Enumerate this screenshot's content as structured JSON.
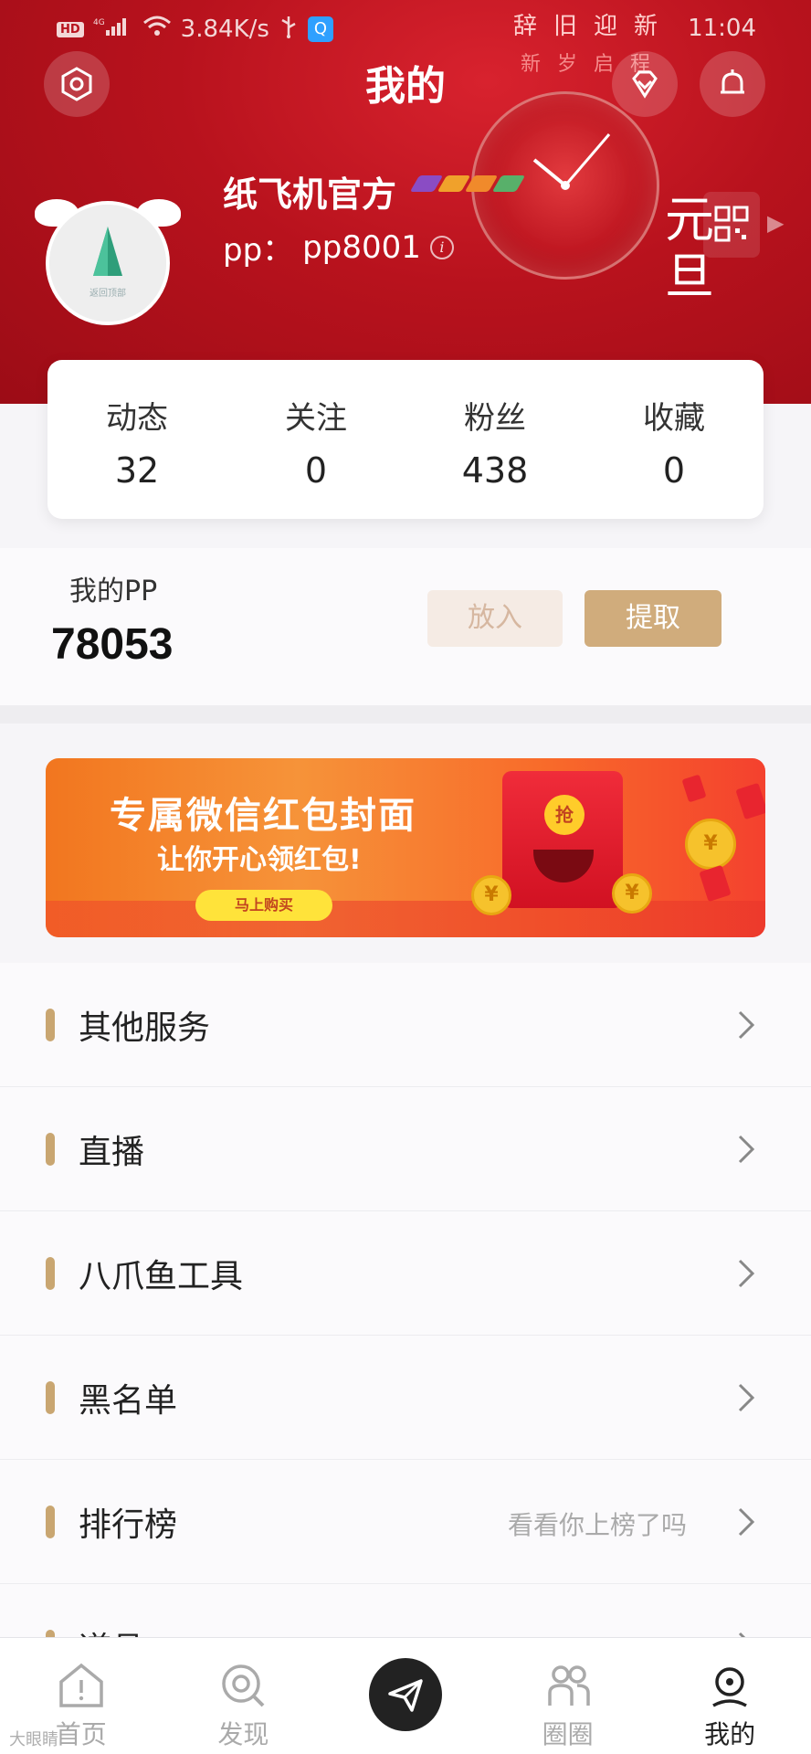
{
  "status_bar": {
    "network_label": "HD",
    "signal_label": "4G",
    "speed": "3.84K/s",
    "time": "11:04"
  },
  "festival": {
    "line1": "辞旧迎新",
    "line2": "新岁启程",
    "yuandan": "元旦"
  },
  "header": {
    "title": "我的",
    "username": "纸飞机官方",
    "pp_label": "pp：",
    "pp_id": "pp8001",
    "avatar_caption": "返回顶部"
  },
  "stats": [
    {
      "label": "动态",
      "value": "32"
    },
    {
      "label": "关注",
      "value": "0"
    },
    {
      "label": "粉丝",
      "value": "438"
    },
    {
      "label": "收藏",
      "value": "0"
    }
  ],
  "wallet": {
    "label": "我的PP",
    "amount": "78053",
    "deposit_label": "放入",
    "withdraw_label": "提取"
  },
  "promo": {
    "title": "专属微信红包封面",
    "subtitle": "让你开心领红包!",
    "button": "马上购买",
    "seal": "抢"
  },
  "menu": [
    {
      "label": "其他服务",
      "hint": ""
    },
    {
      "label": "直播",
      "hint": ""
    },
    {
      "label": "八爪鱼工具",
      "hint": ""
    },
    {
      "label": "黑名单",
      "hint": ""
    },
    {
      "label": "排行榜",
      "hint": "看看你上榜了吗"
    },
    {
      "label": "道具",
      "hint": ""
    }
  ],
  "nav": [
    {
      "label": "首页",
      "icon": "home-icon"
    },
    {
      "label": "发现",
      "icon": "discover-icon"
    },
    {
      "label": "",
      "icon": "paper-plane-icon"
    },
    {
      "label": "圈圈",
      "icon": "circle-group-icon"
    },
    {
      "label": "我的",
      "icon": "profile-icon"
    }
  ],
  "watermark": "大眼睛",
  "colors": {
    "header_red": "#b8121d",
    "accent_gold": "#d0ac7c",
    "menu_bar": "#c9a671"
  }
}
